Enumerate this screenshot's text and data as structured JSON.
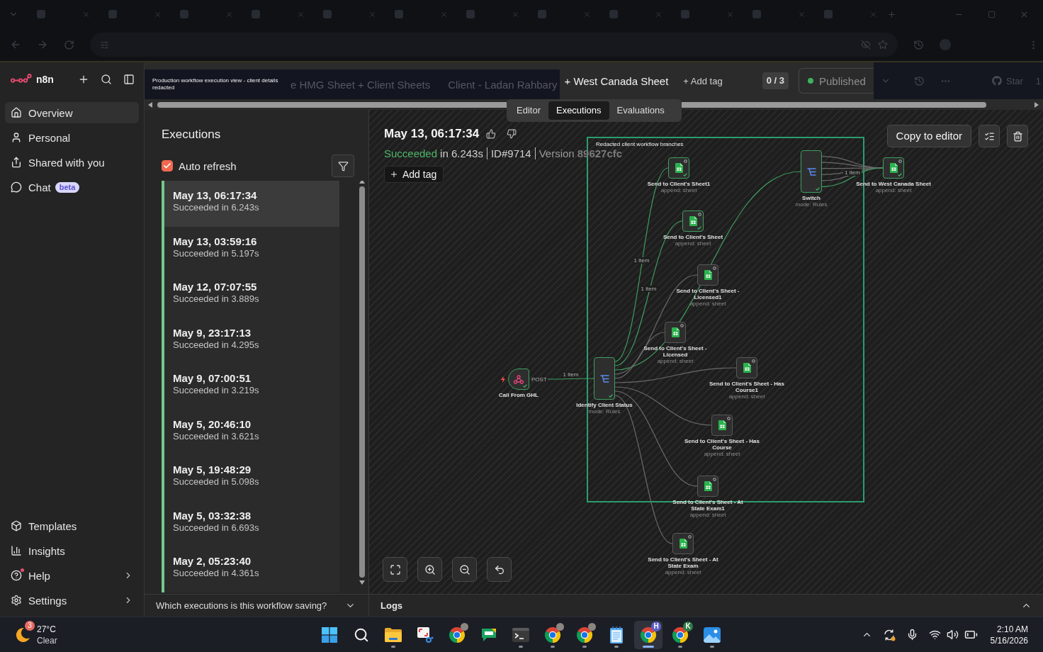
{
  "sidebar": {
    "logo_text": "n8n",
    "nav_items": [
      {
        "label": "Overview",
        "selected": true
      },
      {
        "label": "Personal",
        "selected": false
      },
      {
        "label": "Shared with you",
        "selected": false
      },
      {
        "label": "Chat",
        "badge": "beta",
        "selected": false
      }
    ],
    "bottom_items": [
      {
        "label": "Templates",
        "notification": false,
        "submenu": false
      },
      {
        "label": "Insights",
        "notification": false,
        "submenu": false
      },
      {
        "label": "Help",
        "notification": true,
        "submenu": true
      },
      {
        "label": "Settings",
        "notification": false,
        "submenu": true
      }
    ]
  },
  "header": {
    "redaction_note": "Production workflow execution view - client details redacted",
    "covered_breadcrumbs": [
      "e HMG Sheet + Client Sheets",
      "Client - Ladan Rahbary"
    ],
    "workflow_name": "+ West Canada Sheet",
    "add_tag": "+ Add tag",
    "counter": "0 / 3",
    "publish_button": {
      "label": "Published",
      "active": true
    },
    "github_button": {
      "label": "Star",
      "count": "1"
    }
  },
  "view_tabs": [
    {
      "label": "Editor",
      "selected": false
    },
    {
      "label": "Executions",
      "selected": true
    },
    {
      "label": "Evaluations",
      "selected": false
    }
  ],
  "executions": {
    "title": "Executions",
    "auto_refresh": {
      "label": "Auto refresh",
      "checked": true
    },
    "items": [
      {
        "time": "May 13, 06:17:34",
        "result": "Succeeded in 6.243s",
        "color": "#74c98a",
        "selected": true
      },
      {
        "time": "May 13, 03:59:16",
        "result": "Succeeded in 5.197s",
        "color": "#74c98a",
        "selected": false
      },
      {
        "time": "May 12, 07:07:55",
        "result": "Succeeded in 3.889s",
        "color": "#74c98a",
        "selected": false
      },
      {
        "time": "May 9, 23:17:13",
        "result": "Succeeded in 4.295s",
        "color": "#74c98a",
        "selected": false
      },
      {
        "time": "May 9, 07:00:51",
        "result": "Succeeded in 3.219s",
        "color": "#74c98a",
        "selected": false
      },
      {
        "time": "May 5, 20:46:10",
        "result": "Succeeded in 3.621s",
        "color": "#74c98a",
        "selected": false
      },
      {
        "time": "May 5, 19:48:29",
        "result": "Succeeded in 5.098s",
        "color": "#74c98a",
        "selected": false
      },
      {
        "time": "May 5, 03:32:38",
        "result": "Succeeded in 6.693s",
        "color": "#74c98a",
        "selected": false
      },
      {
        "time": "May 2, 05:23:40",
        "result": "Succeeded in 4.361s",
        "color": "#74c98a",
        "selected": false
      }
    ],
    "footer_question": "Which executions is this workflow saving?"
  },
  "execution_detail": {
    "timestamp": "May 13, 06:17:34",
    "status": {
      "label": "Succeeded",
      "kind": "success"
    },
    "duration": "in 6.243s",
    "execution_id": "ID#9714",
    "version_label": "Version",
    "version": "89627cfc",
    "add_tag": "Add tag",
    "copy_button": "Copy to editor"
  },
  "canvas": {
    "redaction_label": "Redacted client workflow branches",
    "nodes": [
      {
        "name": "Call From GHL",
        "kind": "webhook",
        "executed": true,
        "outputs": [
          {
            "active": true,
            "port_label": "POST",
            "label": "1 item"
          }
        ]
      },
      {
        "name": "Identify Client Status",
        "subtitle": "mode: Rules",
        "kind": "switch",
        "executed": true,
        "outputs": [
          {
            "active": true,
            "label": "1 item"
          },
          {
            "active": true,
            "label": "1 item"
          },
          {
            "active": true
          },
          {
            "active": false
          },
          {
            "active": false
          },
          {
            "active": false
          },
          {
            "active": false
          },
          {
            "active": false
          },
          {
            "active": false
          }
        ]
      },
      {
        "name": "Send to Client's Sheet1",
        "subtitle": "append: sheet",
        "kind": "sheet",
        "executed": true
      },
      {
        "name": "Send to Client's Sheet",
        "subtitle": "append: sheet",
        "kind": "sheet",
        "executed": true
      },
      {
        "name": "Send to Client's Sheet - Licensed1",
        "subtitle": "append: sheet",
        "kind": "sheet",
        "executed": false
      },
      {
        "name": "Send to Client's Sheet - Licensed",
        "subtitle": "append: sheet",
        "kind": "sheet",
        "executed": false
      },
      {
        "name": "Switch",
        "subtitle": "mode: Rules",
        "kind": "switch",
        "executed": true,
        "outputs": [
          {
            "active": false
          },
          {
            "active": false
          },
          {
            "active": false
          },
          {
            "active": false
          },
          {
            "active": false
          },
          {
            "active": true,
            "label": "1 item"
          }
        ]
      },
      {
        "name": "Send to West Canada Sheet",
        "subtitle": "append: sheet",
        "kind": "sheet",
        "executed": true
      },
      {
        "name": "Send to Client's Sheet - Has Course1",
        "subtitle": "append: sheet",
        "kind": "sheet",
        "executed": false
      },
      {
        "name": "Send to Client's Sheet - Has Course",
        "subtitle": "append: sheet",
        "kind": "sheet",
        "executed": false
      },
      {
        "name": "Send to Client's Sheet - At State Exam1",
        "subtitle": "append: sheet",
        "kind": "sheet",
        "executed": false
      },
      {
        "name": "Send to Client's Sheet - At State Exam",
        "subtitle": "append: sheet",
        "kind": "sheet",
        "executed": false
      }
    ]
  },
  "logs_panel": {
    "label": "Logs",
    "expanded": false
  },
  "taskbar": {
    "weather": {
      "alerts": "3",
      "temperature": "27°C",
      "condition": "Clear"
    },
    "apps": [
      {
        "kind": "start",
        "running": false,
        "selected": false,
        "avatar": false
      },
      {
        "kind": "search",
        "running": false,
        "selected": false,
        "avatar": false
      },
      {
        "kind": "files",
        "running": true,
        "selected": false,
        "avatar": false
      },
      {
        "kind": "snipping",
        "running": false,
        "selected": false,
        "avatar": false
      },
      {
        "kind": "browser",
        "running": false,
        "selected": false,
        "avatar": true
      },
      {
        "kind": "chat",
        "running": false,
        "selected": false,
        "avatar": false
      },
      {
        "kind": "terminal",
        "running": true,
        "selected": false,
        "avatar": false
      },
      {
        "kind": "browser",
        "running": true,
        "selected": false,
        "avatar": true
      },
      {
        "kind": "browser",
        "running": true,
        "selected": false,
        "avatar": true
      },
      {
        "kind": "notepad",
        "running": true,
        "selected": false,
        "avatar": false
      },
      {
        "kind": "browser",
        "running": true,
        "selected": true,
        "avatar": false,
        "badge": "H",
        "color": "#5b5fc7"
      },
      {
        "kind": "browser",
        "running": true,
        "selected": false,
        "avatar": false,
        "badge": "K",
        "color": "#2e7d46"
      },
      {
        "kind": "photos",
        "running": true,
        "selected": false,
        "avatar": false
      }
    ],
    "clock": {
      "time": "2:10 AM",
      "date": "5/16/2026"
    }
  }
}
